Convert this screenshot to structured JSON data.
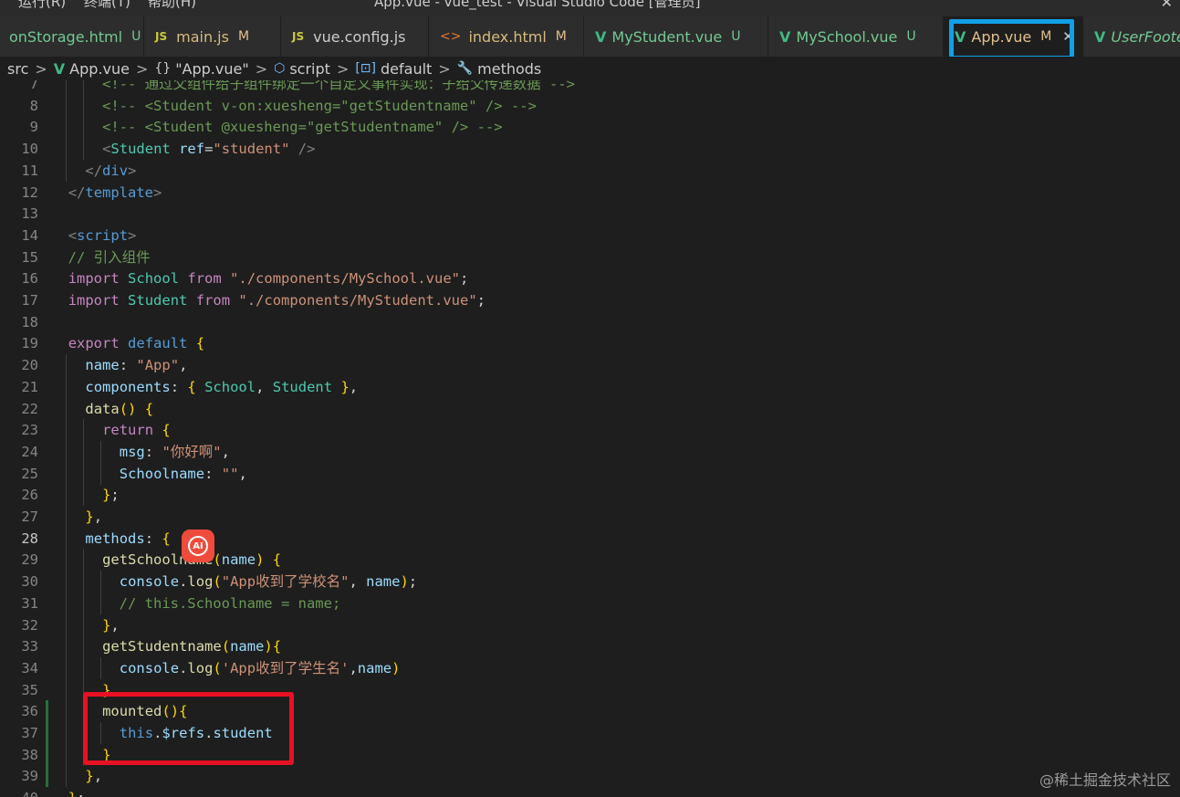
{
  "titlebar": {
    "menus": [
      "运行(R)",
      "终端(T)",
      "帮助(H)"
    ],
    "title": "App.vue - vue_test - Visual Studio Code [管理员]"
  },
  "tabs": [
    {
      "label": "onStorage.html",
      "status": "U",
      "icon": "html-file-icon"
    },
    {
      "label": "main.js",
      "status": "M",
      "icon": "js-file-icon"
    },
    {
      "label": "vue.config.js",
      "status": "",
      "icon": "js-file-icon"
    },
    {
      "label": "index.html",
      "status": "M",
      "icon": "html-file-icon"
    },
    {
      "label": "MyStudent.vue",
      "status": "U",
      "icon": "vue-file-icon"
    },
    {
      "label": "MySchool.vue",
      "status": "U",
      "icon": "vue-file-icon"
    },
    {
      "label": "App.vue",
      "status": "M",
      "icon": "vue-file-icon",
      "active": true
    },
    {
      "label": "UserFoote",
      "status": "",
      "icon": "vue-file-icon"
    }
  ],
  "breadcrumb": {
    "src": "src",
    "file": "App.vue",
    "obj": "\"App.vue\"",
    "script": "script",
    "default": "default",
    "methods": "methods",
    "obj_icon": "{}"
  },
  "editor": {
    "lines": [
      {
        "n": "7",
        "t": "      <!-- 通过父组件给子组件绑定一个自定义事件实现：子给父传递数据 -->"
      },
      {
        "n": "8",
        "t": "      <!-- <Student v-on:xuesheng=\"getStudentname\" /> -->"
      },
      {
        "n": "9",
        "t": "      <!-- <Student @xuesheng=\"getStudentname\" /> -->"
      },
      {
        "n": "10",
        "t": "      <Student ref=\"student\" />"
      },
      {
        "n": "11",
        "t": "    </div>"
      },
      {
        "n": "12",
        "t": "  </template>"
      },
      {
        "n": "13",
        "t": ""
      },
      {
        "n": "14",
        "t": "  <script>"
      },
      {
        "n": "15",
        "t": "  // 引入组件"
      },
      {
        "n": "16",
        "t": "  import School from \"./components/MySchool.vue\";"
      },
      {
        "n": "17",
        "t": "  import Student from \"./components/MyStudent.vue\";"
      },
      {
        "n": "18",
        "t": ""
      },
      {
        "n": "19",
        "t": "  export default {"
      },
      {
        "n": "20",
        "t": "    name: \"App\","
      },
      {
        "n": "21",
        "t": "    components: { School, Student },"
      },
      {
        "n": "22",
        "t": "    data() {"
      },
      {
        "n": "23",
        "t": "      return {"
      },
      {
        "n": "24",
        "t": "        msg: \"你好啊\","
      },
      {
        "n": "25",
        "t": "        Schoolname: \"\","
      },
      {
        "n": "26",
        "t": "      };"
      },
      {
        "n": "27",
        "t": "    },"
      },
      {
        "n": "28",
        "t": "    methods: {"
      },
      {
        "n": "29",
        "t": "      getSchoolname(name) {"
      },
      {
        "n": "30",
        "t": "        console.log(\"App收到了学校名\", name);"
      },
      {
        "n": "31",
        "t": "        // this.Schoolname = name;"
      },
      {
        "n": "32",
        "t": "      },"
      },
      {
        "n": "33",
        "t": "      getStudentname(name){"
      },
      {
        "n": "34",
        "t": "        console.log('App收到了学生名',name)"
      },
      {
        "n": "35",
        "t": "      },"
      },
      {
        "n": "36",
        "t": "      mounted(){"
      },
      {
        "n": "37",
        "t": "        this.$refs.student"
      },
      {
        "n": "38",
        "t": "      }"
      },
      {
        "n": "39",
        "t": "    },"
      },
      {
        "n": "40",
        "t": "  };"
      }
    ]
  },
  "ai_badge": "AI",
  "watermark": "@稀土掘金技术社区",
  "colors": {
    "highlight_blue": "#10a0e8",
    "highlight_red": "#e81123",
    "vue_green": "#41b883"
  }
}
